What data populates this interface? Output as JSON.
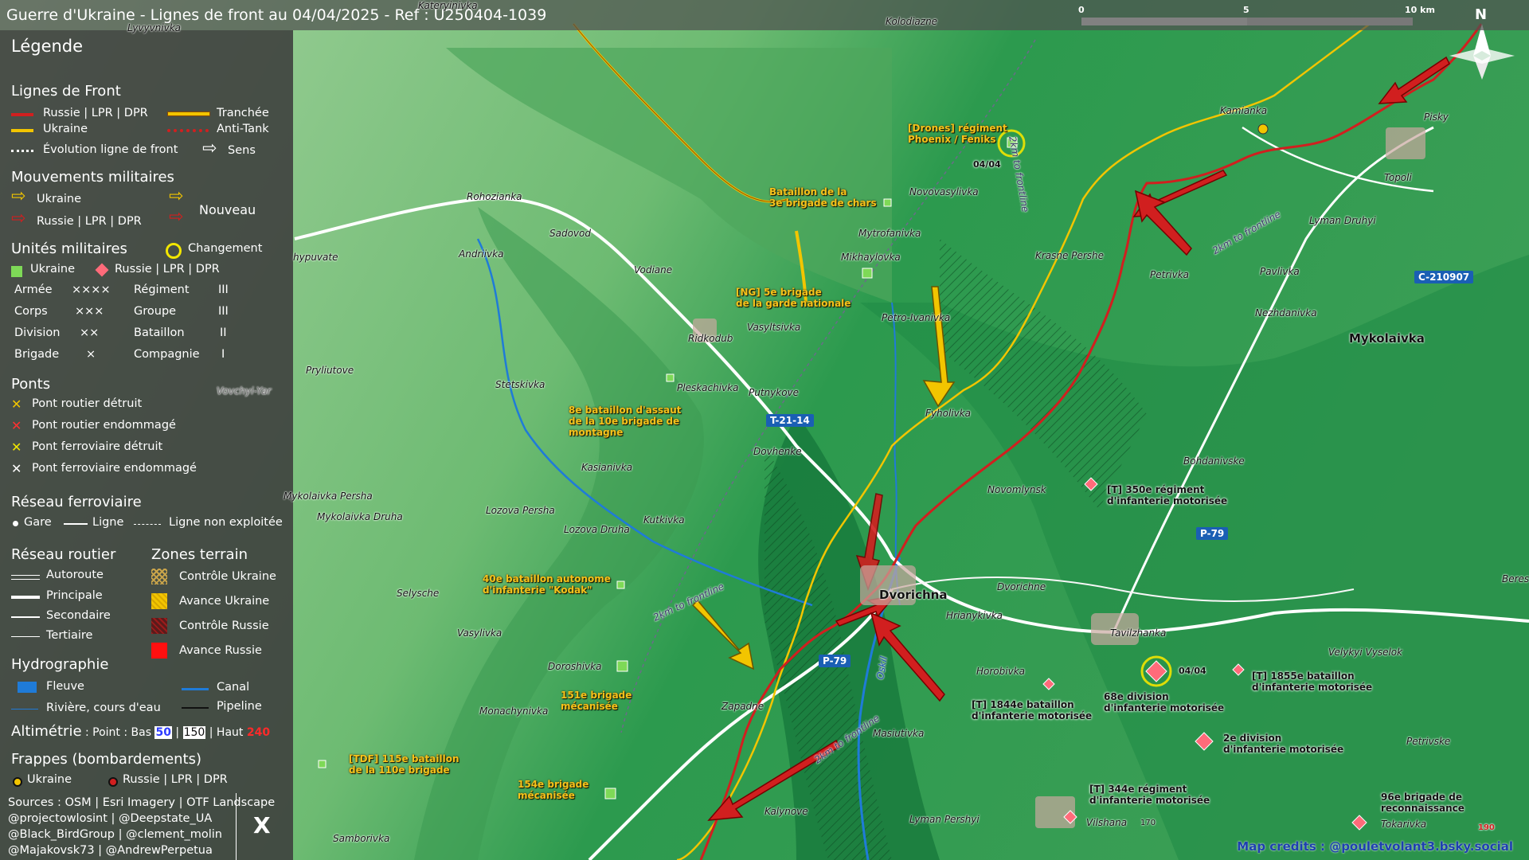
{
  "title": "Guerre d'Ukraine - Lignes de front au 04/04/2025 - Ref : U250404-1039",
  "scale": {
    "labels": [
      "0",
      "5",
      "10 km"
    ]
  },
  "north": "N",
  "colors": {
    "russia": "#d11f1f",
    "ukraine": "#f2c500",
    "panel": "#3c3c3c"
  },
  "legend": {
    "title": "Légende",
    "front_lines": {
      "heading": "Lignes de Front",
      "russia": "Russie | LPR | DPR",
      "ukraine": "Ukraine",
      "evolution": "Évolution ligne de front",
      "trench": "Tranchée",
      "antitank": "Anti-Tank",
      "direction": "Sens"
    },
    "movements": {
      "heading": "Mouvements militaires",
      "ukraine": "Ukraine",
      "russia": "Russie | LPR | DPR",
      "new": "Nouveau"
    },
    "units": {
      "heading": "Unités militaires",
      "change": "Changement",
      "ukraine": "Ukraine",
      "russia": "Russie | LPR | DPR",
      "rows": [
        {
          "a": "Armée",
          "as": "××××",
          "b": "Régiment",
          "bs": "III"
        },
        {
          "a": "Corps",
          "as": "×××",
          "b": "Groupe",
          "bs": "III"
        },
        {
          "a": "Division",
          "as": "××",
          "b": "Bataillon",
          "bs": "II"
        },
        {
          "a": "Brigade",
          "as": "×",
          "b": "Compagnie",
          "bs": "I"
        }
      ]
    },
    "bridges": {
      "heading": "Ponts",
      "items": [
        "Pont routier détruit",
        "Pont routier endommagé",
        "Pont ferroviaire détruit",
        "Pont ferroviaire endommagé"
      ]
    },
    "rail": {
      "heading": "Réseau ferroviaire",
      "station": "Gare",
      "line": "Ligne",
      "unused": "Ligne non exploitée"
    },
    "roads": {
      "heading": "Réseau routier",
      "items": [
        "Autoroute",
        "Principale",
        "Secondaire",
        "Tertiaire"
      ]
    },
    "zones": {
      "heading": "Zones terrain",
      "items": [
        "Contrôle Ukraine",
        "Avance Ukraine",
        "Contrôle Russie",
        "Avance Russie"
      ]
    },
    "hydro": {
      "heading": "Hydrographie",
      "river": "Fleuve",
      "stream": "Rivière, cours d'eau",
      "canal": "Canal",
      "pipeline": "Pipeline"
    },
    "altimetry": {
      "label": "Altimétrie",
      "text": ": Point : Bas",
      "low": "50",
      "sep": "|",
      "mid": "150",
      "high_label": "| Haut",
      "high": "240"
    },
    "strikes": {
      "heading": "Frappes (bombardements)",
      "ukraine": "Ukraine",
      "russia": "Russie | LPR | DPR"
    },
    "sources": [
      "Sources : OSM | Esri Imagery | OTF Landscape",
      "@projectowlosint | @Deepstate_UA",
      "@Black_BirdGroup | @clement_molin",
      "@Majakovsk73 | @AndrewPerpetua"
    ],
    "x_logo": "X"
  },
  "places": [
    {
      "name": "Kateryinivka"
    },
    {
      "name": "Kolodiazne"
    },
    {
      "name": "Lyvyvnivka"
    },
    {
      "name": "Rohozianka"
    },
    {
      "name": "Sadovod"
    },
    {
      "name": "Andriivka"
    },
    {
      "name": "hypuvate"
    },
    {
      "name": "Vodiane"
    },
    {
      "name": "Novovasylivka"
    },
    {
      "name": "Mytrofanivka"
    },
    {
      "name": "Mikhaylovka"
    },
    {
      "name": "Petro-Ivanivka"
    },
    {
      "name": "Vasyltsivka"
    },
    {
      "name": "Ridkodub"
    },
    {
      "name": "Pryliutove"
    },
    {
      "name": "Stetskivka"
    },
    {
      "name": "Pleskachivka"
    },
    {
      "name": "Putnykove"
    },
    {
      "name": "Fyholivka"
    },
    {
      "name": "Dovhenke"
    },
    {
      "name": "Kasianivka"
    },
    {
      "name": "Mykolaivka Persha"
    },
    {
      "name": "Mykolaivka Druha"
    },
    {
      "name": "Lozova Persha"
    },
    {
      "name": "Kutkivka"
    },
    {
      "name": "Lozova Druha"
    },
    {
      "name": "Selysche"
    },
    {
      "name": "Vasylivka"
    },
    {
      "name": "Doroshivka"
    },
    {
      "name": "Monachynivka"
    },
    {
      "name": "Zapadne"
    },
    {
      "name": "Masiutivka"
    },
    {
      "name": "Kalynove"
    },
    {
      "name": "Lyman Pershyi"
    },
    {
      "name": "Samborivka"
    },
    {
      "name": "Hrianykivka"
    },
    {
      "name": "Horobivka"
    },
    {
      "name": "Dvorichne"
    },
    {
      "name": "Novomlynsk"
    },
    {
      "name": "Tavilzhanka"
    },
    {
      "name": "Vilshana"
    },
    {
      "name": "Kamianka"
    },
    {
      "name": "Pisky"
    },
    {
      "name": "Topoli"
    },
    {
      "name": "Lyman Druhyi"
    },
    {
      "name": "Krasne Pershe"
    },
    {
      "name": "Petrivka"
    },
    {
      "name": "Pavlivka"
    },
    {
      "name": "Nezhdanivka"
    },
    {
      "name": "Bohdanivske"
    },
    {
      "name": "Velykyi Vyselok"
    },
    {
      "name": "Petrivske"
    },
    {
      "name": "Tokarivka"
    },
    {
      "name": "Beres"
    },
    {
      "name": "Vovchyi-Yar"
    }
  ],
  "big_places": [
    {
      "name": "Dvorichna"
    },
    {
      "name": "Mykolaivka"
    }
  ],
  "roads_labels": [
    {
      "name": "T-21-14"
    },
    {
      "name": "P-79"
    },
    {
      "name": "P-79"
    },
    {
      "name": "C-210907"
    }
  ],
  "frontline_notes": [
    "2km to frontline",
    "2km to frontline",
    "2km to frontline",
    "2km to frontline"
  ],
  "river_label": "Oskil",
  "ua_units": [
    {
      "l1": "[Drones] régiment",
      "l2": "Phoenix / Feniks"
    },
    {
      "l1": "Bataillon de la",
      "l2": "3e brigade de chars"
    },
    {
      "l1": "[NG] 5e brigade",
      "l2": "de la garde nationale"
    },
    {
      "l1": "8e bataillon d'assaut",
      "l2": "de la 10e brigade de",
      "l3": "montagne"
    },
    {
      "l1": "40e bataillon autonome",
      "l2": "d'infanterie \"Kodak\""
    },
    {
      "l1": "151e brigade",
      "l2": "mécanisée"
    },
    {
      "l1": "[TDF] 115e bataillon",
      "l2": "de la 110e brigade"
    },
    {
      "l1": "154e brigade",
      "l2": "mécanisée"
    }
  ],
  "ru_units": [
    {
      "l1": "[T] 350e régiment",
      "l2": "d'infanterie motorisée"
    },
    {
      "l1": "[T] 1844e bataillon",
      "l2": "d'infanterie motorisée"
    },
    {
      "l1": "68e division",
      "l2": "d'infanterie motorisée"
    },
    {
      "l1": "[T] 1855e bataillon",
      "l2": "d'infanterie motorisée"
    },
    {
      "l1": "2e division",
      "l2": "d'infanterie motorisée"
    },
    {
      "l1": "[T] 344e régiment",
      "l2": "d'infanterie motorisée"
    },
    {
      "l1": "96e brigade de",
      "l2": "reconnaissance"
    }
  ],
  "dates": [
    "04/04",
    "04/04"
  ],
  "elevations": [
    "170",
    "190"
  ],
  "credit": "Map credits : @pouletvolant3.bsky.social"
}
